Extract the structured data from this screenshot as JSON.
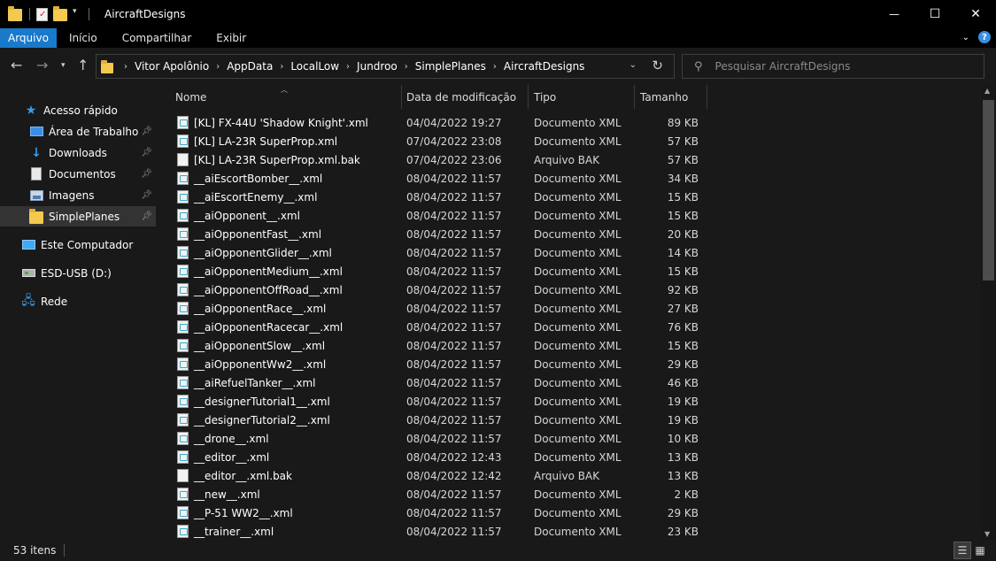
{
  "window": {
    "title": "AircraftDesigns",
    "controls": {
      "minimize": "—",
      "maximize": "☐",
      "close": "✕"
    }
  },
  "ribbon": {
    "tabs": [
      "Arquivo",
      "Início",
      "Compartilhar",
      "Exibir"
    ],
    "active_tab": "Arquivo",
    "help": "?"
  },
  "address": {
    "path": [
      "Vitor Apolônio",
      "AppData",
      "LocalLow",
      "Jundroo",
      "SimplePlanes",
      "AircraftDesigns"
    ]
  },
  "search": {
    "placeholder": "Pesquisar AircraftDesigns"
  },
  "sidebar": {
    "items": [
      {
        "label": "Acesso rápido",
        "icon": "star-icon"
      },
      {
        "label": "Área de Trabalho",
        "icon": "desktop-icon",
        "pinned": true
      },
      {
        "label": "Downloads",
        "icon": "download-icon",
        "pinned": true
      },
      {
        "label": "Documentos",
        "icon": "document-icon",
        "pinned": true
      },
      {
        "label": "Imagens",
        "icon": "image-icon",
        "pinned": true
      },
      {
        "label": "SimplePlanes",
        "icon": "folder-icon",
        "pinned": true,
        "selected": true
      },
      {
        "label": "Este Computador",
        "icon": "computer-icon"
      },
      {
        "label": "ESD-USB (D:)",
        "icon": "usb-drive-icon"
      },
      {
        "label": "Rede",
        "icon": "network-icon"
      }
    ]
  },
  "columns": {
    "name": "Nome",
    "date": "Data de modificação",
    "type": "Tipo",
    "size": "Tamanho"
  },
  "files": [
    {
      "name": "[KL] FX-44U 'Shadow Knight'.xml",
      "date": "04/04/2022 19:27",
      "type": "Documento XML",
      "size": "89 KB"
    },
    {
      "name": "[KL] LA-23R SuperProp.xml",
      "date": "07/04/2022 23:08",
      "type": "Documento XML",
      "size": "57 KB"
    },
    {
      "name": "[KL] LA-23R SuperProp.xml.bak",
      "date": "07/04/2022 23:06",
      "type": "Arquivo BAK",
      "size": "57 KB"
    },
    {
      "name": "__aiEscortBomber__.xml",
      "date": "08/04/2022 11:57",
      "type": "Documento XML",
      "size": "34 KB"
    },
    {
      "name": "__aiEscortEnemy__.xml",
      "date": "08/04/2022 11:57",
      "type": "Documento XML",
      "size": "15 KB"
    },
    {
      "name": "__aiOpponent__.xml",
      "date": "08/04/2022 11:57",
      "type": "Documento XML",
      "size": "15 KB"
    },
    {
      "name": "__aiOpponentFast__.xml",
      "date": "08/04/2022 11:57",
      "type": "Documento XML",
      "size": "20 KB"
    },
    {
      "name": "__aiOpponentGlider__.xml",
      "date": "08/04/2022 11:57",
      "type": "Documento XML",
      "size": "14 KB"
    },
    {
      "name": "__aiOpponentMedium__.xml",
      "date": "08/04/2022 11:57",
      "type": "Documento XML",
      "size": "15 KB"
    },
    {
      "name": "__aiOpponentOffRoad__.xml",
      "date": "08/04/2022 11:57",
      "type": "Documento XML",
      "size": "92 KB"
    },
    {
      "name": "__aiOpponentRace__.xml",
      "date": "08/04/2022 11:57",
      "type": "Documento XML",
      "size": "27 KB"
    },
    {
      "name": "__aiOpponentRacecar__.xml",
      "date": "08/04/2022 11:57",
      "type": "Documento XML",
      "size": "76 KB"
    },
    {
      "name": "__aiOpponentSlow__.xml",
      "date": "08/04/2022 11:57",
      "type": "Documento XML",
      "size": "15 KB"
    },
    {
      "name": "__aiOpponentWw2__.xml",
      "date": "08/04/2022 11:57",
      "type": "Documento XML",
      "size": "29 KB"
    },
    {
      "name": "__aiRefuelTanker__.xml",
      "date": "08/04/2022 11:57",
      "type": "Documento XML",
      "size": "46 KB"
    },
    {
      "name": "__designerTutorial1__.xml",
      "date": "08/04/2022 11:57",
      "type": "Documento XML",
      "size": "19 KB"
    },
    {
      "name": "__designerTutorial2__.xml",
      "date": "08/04/2022 11:57",
      "type": "Documento XML",
      "size": "19 KB"
    },
    {
      "name": "__drone__.xml",
      "date": "08/04/2022 11:57",
      "type": "Documento XML",
      "size": "10 KB"
    },
    {
      "name": "__editor__.xml",
      "date": "08/04/2022 12:43",
      "type": "Documento XML",
      "size": "13 KB"
    },
    {
      "name": "__editor__.xml.bak",
      "date": "08/04/2022 12:42",
      "type": "Arquivo BAK",
      "size": "13 KB"
    },
    {
      "name": "__new__.xml",
      "date": "08/04/2022 11:57",
      "type": "Documento XML",
      "size": "2 KB"
    },
    {
      "name": "__P-51 WW2__.xml",
      "date": "08/04/2022 11:57",
      "type": "Documento XML",
      "size": "29 KB"
    },
    {
      "name": "__trainer__.xml",
      "date": "08/04/2022 11:57",
      "type": "Documento XML",
      "size": "23 KB"
    }
  ],
  "status": {
    "item_count": "53 itens"
  },
  "colors": {
    "accent": "#1979ca",
    "background": "#191919",
    "selected": "#333333"
  }
}
